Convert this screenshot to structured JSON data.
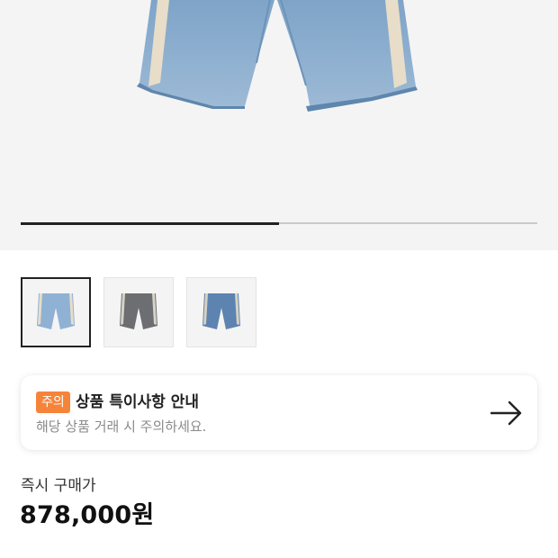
{
  "gallery": {
    "slide_progress": 0.5,
    "product_icon": "denim-shorts-icon",
    "thumbnails": [
      {
        "icon": "denim-shorts-light-icon",
        "color": "#8fb1d3",
        "selected": true
      },
      {
        "icon": "denim-shorts-gray-icon",
        "color": "#6c6e72",
        "selected": false
      },
      {
        "icon": "denim-shorts-blue-icon",
        "color": "#5d83b0",
        "selected": false
      }
    ]
  },
  "notice": {
    "badge": "주의",
    "title": "상품 특이사항 안내",
    "description": "해당 상품 거래 시 주의하세요.",
    "arrow_icon": "arrow-right-icon",
    "badge_color": "#f5843a"
  },
  "price": {
    "label": "즉시 구매가",
    "value": "878,000원"
  }
}
